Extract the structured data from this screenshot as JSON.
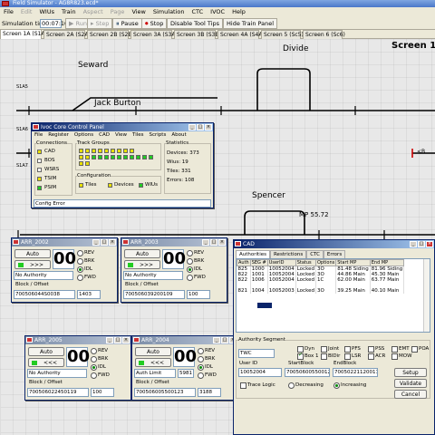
{
  "window": {
    "title": "Field Simulator - AG8R823.ecd*"
  },
  "menu": [
    {
      "label": "File",
      "enabled": true
    },
    {
      "label": "Edit",
      "enabled": false
    },
    {
      "label": "WIUs",
      "enabled": true
    },
    {
      "label": "Train",
      "enabled": true
    },
    {
      "label": "Aspect",
      "enabled": false
    },
    {
      "label": "Page",
      "enabled": false
    },
    {
      "label": "View",
      "enabled": true
    },
    {
      "label": "Simulation",
      "enabled": true
    },
    {
      "label": "CTC",
      "enabled": true
    },
    {
      "label": "IVOC",
      "enabled": true
    },
    {
      "label": "Help",
      "enabled": true
    }
  ],
  "toolbar": {
    "sim_time_label": "Simulation time:",
    "sim_time": "00:07:10",
    "run": "Run",
    "step": "Step",
    "pause": "Pause",
    "stop": "Stop",
    "disable_tips": "Disable Tool Tips",
    "hide_panel": "Hide Train Panel"
  },
  "tabs": [
    "Screen 1A (S1A)",
    "Screen 2A (S2A)",
    "Screen 2B (S2B)",
    "Screen 3A (S3A)",
    "Screen 3B (S3B)",
    "Screen 4A (S4A)",
    "Screen 5 (Sc5)",
    "Screen 6 (Sc6)"
  ],
  "canvas": {
    "screen_title": "Screen 1",
    "labels": {
      "seward": "Seward",
      "divide": "Divide",
      "jack_burton": "Jack Burton",
      "spencer": "Spencer",
      "mp": "MP 55.72",
      "s1a5": "S1A5",
      "s1a6": "S1A6",
      "s1a7": "S1A7",
      "arrow": "<B"
    }
  },
  "ivoc": {
    "title": "Ivoc Core Control Panel",
    "menu": [
      "File",
      "Register",
      "Options",
      "CAD",
      "View",
      "Tiles",
      "Scripts",
      "About"
    ],
    "connections_label": "Connections",
    "connections": [
      {
        "label": "CAD",
        "color": "#e8e000"
      },
      {
        "label": "BOS",
        "color": "#ffffff"
      },
      {
        "label": "WSRS",
        "color": "#ffffff"
      },
      {
        "label": "TSIM",
        "color": "#e8e000"
      },
      {
        "label": "PSIM",
        "color": "#22cc22"
      }
    ],
    "track_groups_label": "Track Groups",
    "configuration_label": "Configuration",
    "config": [
      {
        "label": "Tiles",
        "color": "#e8e000"
      },
      {
        "label": "Devices",
        "color": "#e8e000"
      },
      {
        "label": "WIUs",
        "color": "#22cc22"
      }
    ],
    "stats_label": "Statistics",
    "stats": {
      "devices": "Devices: 373",
      "wius": "Wius: 19",
      "tiles": "Tiles: 331",
      "errors": "Errors: 108"
    },
    "status": "Config Error"
  },
  "arr_panels": [
    {
      "title": "ARR_2002",
      "count": "00",
      "auto": "Auto",
      "fwd": ">>>",
      "back": "<<<",
      "mode": "No Authority",
      "field2": "",
      "radios": [
        "REV",
        "BRK",
        "IDL",
        "FWD"
      ],
      "selected": "IDL",
      "block_label": "Block / Offset",
      "block": "700506044S0038",
      "offset": "1403"
    },
    {
      "title": "ARR_2003",
      "count": "00",
      "auto": "Auto",
      "fwd": ">>>",
      "back": "<<<",
      "mode": "No Authority",
      "field2": "",
      "radios": [
        "REV",
        "BRK",
        "IDL",
        "FWD"
      ],
      "selected": "IDL",
      "block_label": "Block / Offset",
      "block": "700506039200109",
      "offset": "100"
    },
    {
      "title": "ARR_2005",
      "count": "00",
      "auto": "Auto",
      "fwd": ">>>",
      "back": "<<<",
      "mode": "No Authority",
      "field2": "",
      "radios": [
        "REV",
        "BRK",
        "IDL",
        "FWD"
      ],
      "selected": "IDL",
      "block_label": "Block / Offset",
      "block": "700506022450119",
      "offset": "100"
    },
    {
      "title": "ARR_2004",
      "count": "00",
      "auto": "Auto",
      "fwd": ">>>",
      "back": "<<<",
      "mode": "Auth Limit",
      "field2": "5981",
      "radios": [
        "REV",
        "BRK",
        "IDL",
        "FWD"
      ],
      "selected": "IDL",
      "block_label": "Block / Offset",
      "block": "700506005500123",
      "offset": "3188"
    }
  ],
  "cad": {
    "title": "CAD",
    "tabs": [
      "Authorities",
      "Restrictions",
      "CTC",
      "Errors"
    ],
    "columns": [
      "Auth",
      "SEG #",
      "UserID",
      "Status",
      "Options",
      "Start MP",
      "End MP"
    ],
    "rows": [
      [
        "825",
        "1000",
        "10052004",
        "Locked",
        "3O",
        "81.48 Siding",
        "81.96 Siding"
      ],
      [
        "822",
        "1001",
        "10052004",
        "Locked",
        "3O",
        "44.86 Main",
        "45.30 Main"
      ],
      [
        "822",
        "1006",
        "10052004",
        "Locked",
        "1C",
        "62.00 Main",
        "63.77 Main"
      ],
      [
        "",
        "",
        "",
        "",
        "",
        "",
        ""
      ],
      [
        "821",
        "1004",
        "10052003",
        "Locked",
        "3O",
        "39.25 Main",
        "40.10 Main"
      ]
    ],
    "segment_label": "Authority Segment",
    "type": "TWC",
    "checks": [
      "Dyn",
      "Joint",
      "PFS",
      "PSS",
      "EMT",
      "POA",
      "Box 1",
      "BIDir",
      "LSR",
      "ACR",
      "MOW"
    ],
    "checked": [
      "Box 1"
    ],
    "user_id_label": "User ID",
    "user_id": "10052004",
    "start_label": "StartBlock",
    "start": "700506005500123",
    "end_label": "EndBlock",
    "end": "700502211200119",
    "trace": "Trace Logic",
    "decreasing": "Decreasing",
    "increasing": "Increasing",
    "setup": "Setup",
    "validate": "Validate",
    "cancel": "Cancel"
  }
}
